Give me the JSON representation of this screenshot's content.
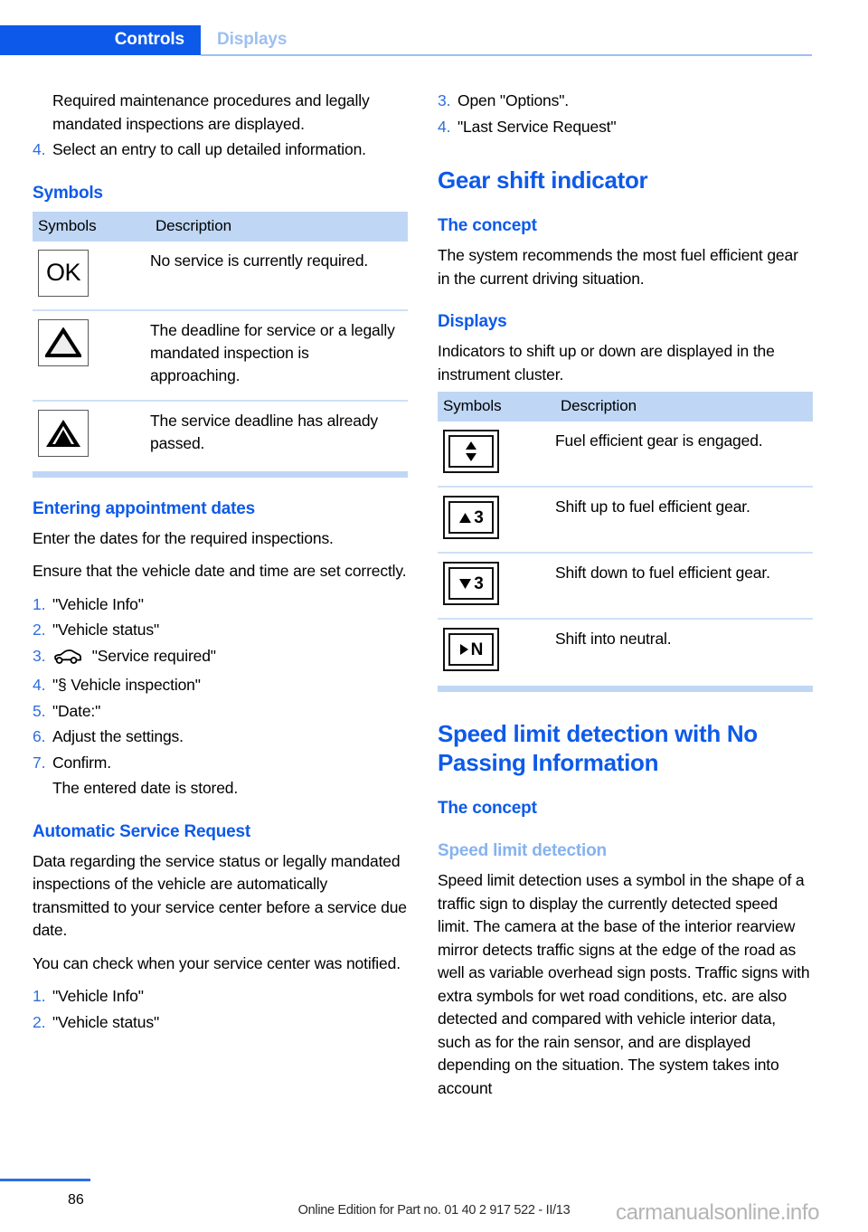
{
  "header": {
    "active_tab": "Controls",
    "inactive_tab": "Displays"
  },
  "left_column": {
    "continued_step_text": "Required maintenance procedures and legally mandated inspections are displayed.",
    "step_4_num": "4.",
    "step_4_text": "Select an entry to call up detailed information.",
    "symbols_heading": "Symbols",
    "symbols_table": {
      "col_symbols": "Symbols",
      "col_description": "Description",
      "rows": [
        {
          "symbol": "ok-box-icon",
          "symbol_text": "OK",
          "description": "No service is currently required."
        },
        {
          "symbol": "warning-triangle-outline-icon",
          "symbol_text": "",
          "description": "The deadline for service or a legally mandated inspection is approaching."
        },
        {
          "symbol": "warning-triangle-filled-icon",
          "symbol_text": "",
          "description": "The service deadline has already passed."
        }
      ]
    },
    "entering_heading": "Entering appointment dates",
    "entering_p1": "Enter the dates for the required inspections.",
    "entering_p2": "Ensure that the vehicle date and time are set correctly.",
    "entering_steps": [
      {
        "num": "1.",
        "text": "\"Vehicle Info\"",
        "icon": ""
      },
      {
        "num": "2.",
        "text": "\"Vehicle status\"",
        "icon": ""
      },
      {
        "num": "3.",
        "text": "\"Service required\"",
        "icon": "car-icon"
      },
      {
        "num": "4.",
        "text": "\"§ Vehicle inspection\"",
        "icon": ""
      },
      {
        "num": "5.",
        "text": "\"Date:\"",
        "icon": ""
      },
      {
        "num": "6.",
        "text": "Adjust the settings.",
        "icon": ""
      },
      {
        "num": "7.",
        "text": "Confirm.",
        "icon": ""
      },
      {
        "num": "",
        "text": "The entered date is stored.",
        "icon": ""
      }
    ],
    "automatic_heading": "Automatic Service Request",
    "automatic_p1": "Data regarding the service status or legally mandated inspections of the vehicle are automatically transmitted to your service center before a service due date.",
    "automatic_p2": "You can check when your service center was notified.",
    "automatic_steps": [
      {
        "num": "1.",
        "text": "\"Vehicle Info\""
      },
      {
        "num": "2.",
        "text": "\"Vehicle status\""
      }
    ]
  },
  "right_column": {
    "continued_steps": [
      {
        "num": "3.",
        "text": "Open \"Options\"."
      },
      {
        "num": "4.",
        "text": "\"Last Service Request\""
      }
    ],
    "gear_heading": "Gear shift indicator",
    "gear_concept_heading": "The concept",
    "gear_concept_text": "The system recommends the most fuel efficient gear in the current driving situation.",
    "gear_displays_heading": "Displays",
    "gear_displays_text": "Indicators to shift up or down are displayed in the instrument cluster.",
    "gear_table": {
      "col_symbols": "Symbols",
      "col_description": "Description",
      "rows": [
        {
          "symbol": "up-down-arrow-icon",
          "digit": "",
          "description": "Fuel efficient gear is engaged."
        },
        {
          "symbol": "arrow-up-gear-icon",
          "digit": "3",
          "description": "Shift up to fuel efficient gear."
        },
        {
          "symbol": "arrow-down-gear-icon",
          "digit": "3",
          "description": "Shift down to fuel efficient gear."
        },
        {
          "symbol": "arrow-right-neutral-icon",
          "digit": "N",
          "description": "Shift into neutral."
        }
      ]
    },
    "speed_heading": "Speed limit detection with No Passing Information",
    "speed_concept_heading": "The concept",
    "speed_sub_heading": "Speed limit detection",
    "speed_body": "Speed limit detection uses a symbol in the shape of a traffic sign to display the currently detected speed limit. The camera at the base of the interior rearview mirror detects traffic signs at the edge of the road as well as variable overhead sign posts. Traffic signs with extra symbols for wet road conditions, etc. are also detected and compared with vehicle interior data, such as for the rain sensor, and are displayed depending on the situation. The system takes into account"
  },
  "footer": {
    "page_number": "86",
    "edition_note": "Online Edition for Part no. 01 40 2 917 522 - II/13",
    "watermark": "carmanualsonline.info"
  },
  "colors": {
    "accent_blue": "#0d5aea",
    "light_blue": "#86b2ef",
    "table_header_blue": "#bfd7f5",
    "step_number_blue": "#2f6fe0"
  }
}
